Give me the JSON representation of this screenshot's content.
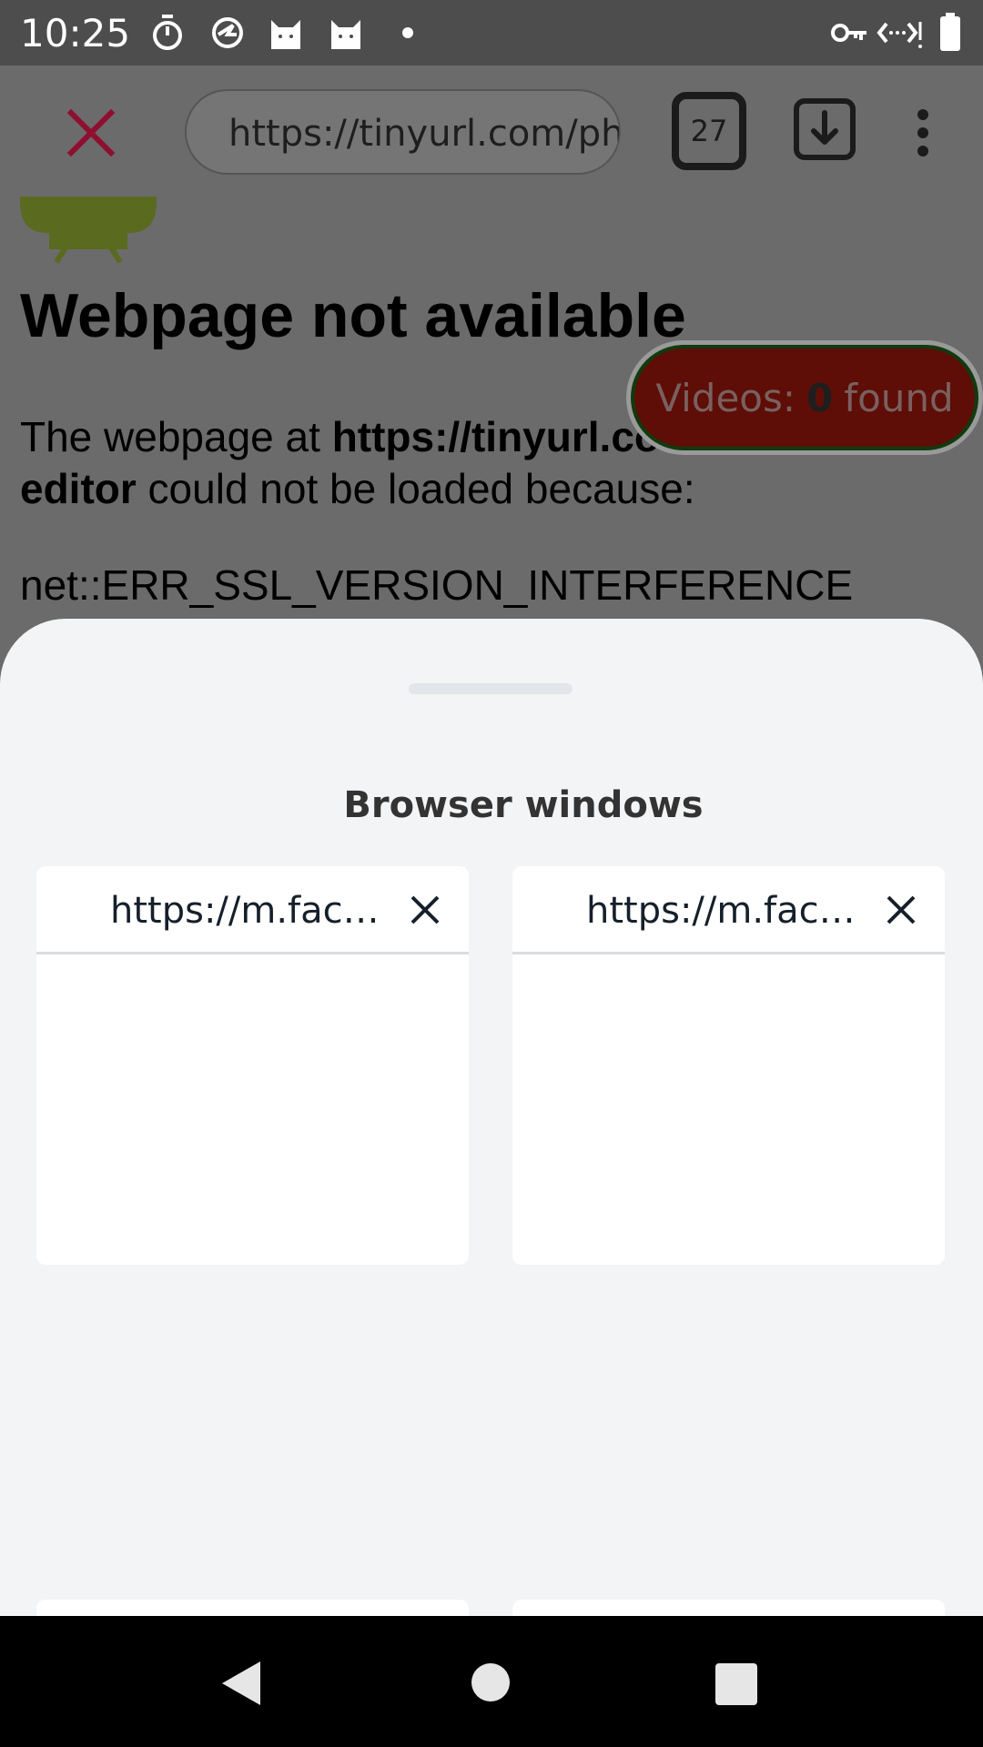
{
  "status_bar": {
    "time": "10:25",
    "left_icons": [
      "stopwatch-icon",
      "sync-app-icon",
      "cat-app-icon",
      "cat-app-icon",
      "notification-dot-icon"
    ],
    "right_icons": [
      "vpn-key-icon",
      "data-transfer-icon",
      "battery-icon"
    ]
  },
  "toolbar": {
    "close_icon": "close-icon",
    "url": "https://tinyurl.com/ph",
    "tab_count": "27",
    "download_icon": "download-icon",
    "menu_icon": "more-vert-icon",
    "accent_color": "#b0183c"
  },
  "page": {
    "heading": "Webpage not available",
    "msg_prefix": "The webpage at ",
    "msg_url_line1": "https://tinyurl.co",
    "msg_url_line2": "editor",
    "msg_suffix": " could not be loaded because:",
    "error_code": "net::ERR_SSL_VERSION_INTERFERENCE"
  },
  "videos_pill": {
    "prefix": "Videos:",
    "count": "0",
    "suffix": "found"
  },
  "sheet": {
    "title": "Browser windows",
    "windows": [
      {
        "url": "https://m.facebook.com"
      },
      {
        "url": "https://m.facebook.com"
      }
    ]
  }
}
